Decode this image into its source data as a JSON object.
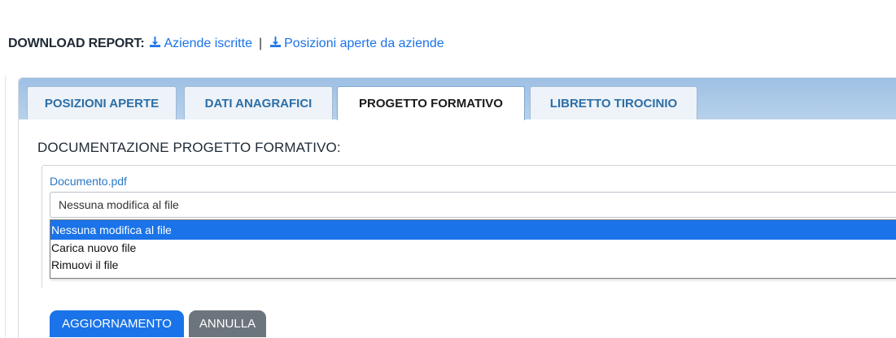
{
  "download": {
    "label": "DOWNLOAD REPORT:",
    "links": [
      "Aziende iscritte",
      "Posizioni aperte da aziende"
    ],
    "separator": "|",
    "icon": "download-icon"
  },
  "tabs": [
    {
      "label": "POSIZIONI APERTE",
      "active": false
    },
    {
      "label": "DATI ANAGRAFICI",
      "active": false
    },
    {
      "label": "PROGETTO FORMATIVO",
      "active": true
    },
    {
      "label": "LIBRETTO TIROCINIO",
      "active": false
    }
  ],
  "section": {
    "title": "DOCUMENTAZIONE PROGETTO FORMATIVO:",
    "file_link": "Documento.pdf",
    "select_value": "Nessuna modifica al file",
    "options": [
      "Nessuna modifica al file",
      "Carica nuovo file",
      "Rimuovi il file"
    ],
    "selected_index": 0
  },
  "buttons": {
    "update": "AGGIORNAMENTO",
    "cancel": "ANNULLA"
  },
  "colors": {
    "accent": "#1a73e8",
    "tab_text": "#2c6ea6",
    "cancel": "#6c757d"
  }
}
